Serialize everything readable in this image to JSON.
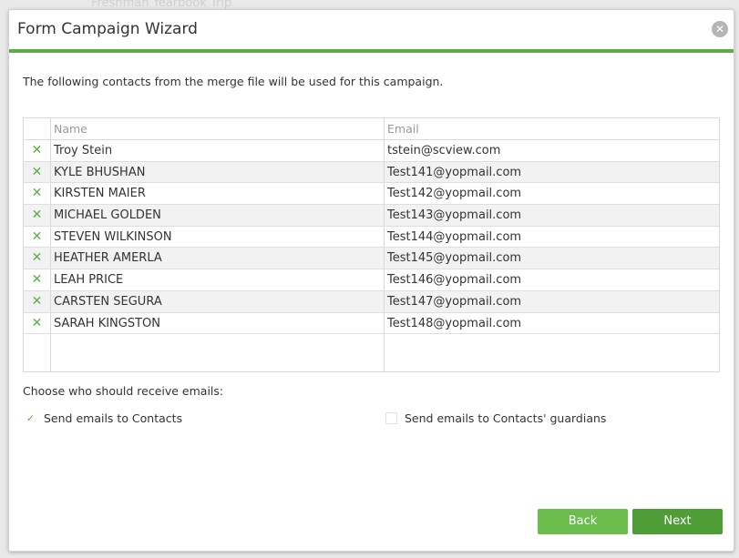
{
  "background": {
    "ghost_text": "Freshman Yearbook Trip"
  },
  "dialog": {
    "title": "Form Campaign Wizard",
    "close_icon": "close-icon"
  },
  "intro_text": "The following contacts from the merge file will be used for this campaign.",
  "table": {
    "columns": [
      "Name",
      "Email"
    ],
    "rows": [
      {
        "status_icon": "x-icon",
        "name": "Troy Stein",
        "email": "tstein@scview.com"
      },
      {
        "status_icon": "x-icon",
        "name": "KYLE BHUSHAN",
        "email": "Test141@yopmail.com"
      },
      {
        "status_icon": "x-icon",
        "name": "KIRSTEN MAIER",
        "email": "Test142@yopmail.com"
      },
      {
        "status_icon": "x-icon",
        "name": "MICHAEL GOLDEN",
        "email": "Test143@yopmail.com"
      },
      {
        "status_icon": "x-icon",
        "name": "STEVEN WILKINSON",
        "email": "Test144@yopmail.com"
      },
      {
        "status_icon": "x-icon",
        "name": "HEATHER AMERLA",
        "email": "Test145@yopmail.com"
      },
      {
        "status_icon": "x-icon",
        "name": "LEAH PRICE",
        "email": "Test146@yopmail.com"
      },
      {
        "status_icon": "x-icon",
        "name": "CARSTEN SEGURA",
        "email": "Test147@yopmail.com"
      },
      {
        "status_icon": "x-icon",
        "name": "SARAH KINGSTON",
        "email": "Test148@yopmail.com"
      }
    ]
  },
  "recipients": {
    "label": "Choose who should receive emails:",
    "options": [
      {
        "label": "Send emails to Contacts",
        "checked": true
      },
      {
        "label": "Send emails to Contacts' guardians",
        "checked": false
      }
    ]
  },
  "buttons": {
    "back": "Back",
    "next": "Next"
  },
  "colors": {
    "accent": "#5cad46",
    "button_back": "#6bbd4e",
    "button_next": "#4f9d37"
  }
}
